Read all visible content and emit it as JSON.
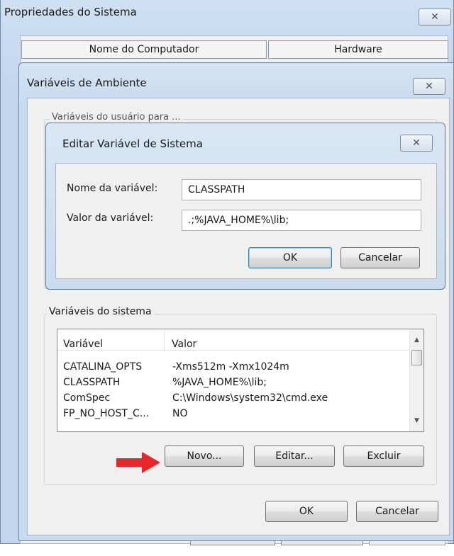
{
  "outer_window": {
    "title": "Propriedades do Sistema",
    "tabs": [
      {
        "label": "Nome do Computador"
      },
      {
        "label": "Hardware"
      }
    ]
  },
  "env_window": {
    "title": "Variáveis de Ambiente",
    "user_group_label": "Variáveis do usuário para ...",
    "system_group_label": "Variáveis do sistema",
    "columns": {
      "name": "Variável",
      "value": "Valor"
    },
    "rows": [
      {
        "name": "CATALINA_OPTS",
        "value": "-Xms512m -Xmx1024m"
      },
      {
        "name": "CLASSPATH",
        "value": "%JAVA_HOME%\\lib;"
      },
      {
        "name": "ComSpec",
        "value": "C:\\Windows\\system32\\cmd.exe"
      },
      {
        "name": "FP_NO_HOST_C...",
        "value": "NO"
      }
    ],
    "buttons": {
      "new": "Novo...",
      "edit": "Editar...",
      "delete": "Excluir",
      "ok": "OK",
      "cancel": "Cancelar"
    }
  },
  "edit_dialog": {
    "title": "Editar Variável de Sistema",
    "name_label": "Nome da variável:",
    "name_value": "CLASSPATH",
    "value_label": "Valor da variável:",
    "value_value": ".;%JAVA_HOME%\\lib;",
    "ok": "OK",
    "cancel": "Cancelar"
  },
  "icons": {
    "close": "close-icon",
    "arrow": "red-arrow-icon",
    "scroll_up": "chevron-up-icon",
    "scroll_down": "chevron-down-icon"
  },
  "colors": {
    "arrow": "#e5262a",
    "title_bar": "#c3d6ee"
  }
}
